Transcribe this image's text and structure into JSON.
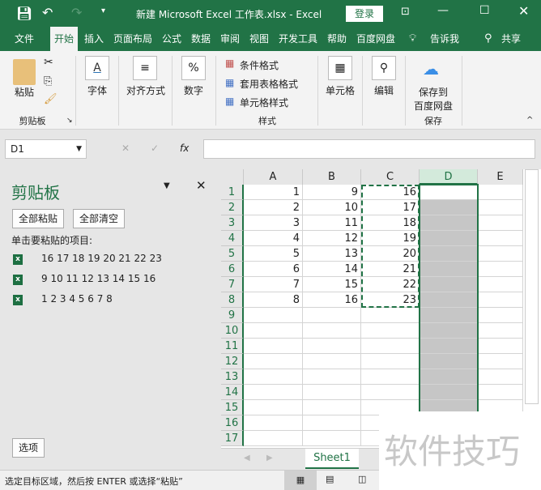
{
  "titlebar": {
    "title": "新建 Microsoft Excel 工作表.xlsx  -  Excel",
    "login": "登录",
    "qat": {
      "save": "save-icon",
      "undo": "undo-icon",
      "redo": "redo-icon"
    }
  },
  "tabs": [
    "文件",
    "开始",
    "插入",
    "页面布局",
    "公式",
    "数据",
    "审阅",
    "视图",
    "开发工具",
    "帮助",
    "百度网盘"
  ],
  "tell_me": "告诉我",
  "share": "共享",
  "active_tab": "开始",
  "ribbon": {
    "paste": "粘贴",
    "clipboard": "剪贴板",
    "font": "字体",
    "alignment": "对齐方式",
    "number": "数字",
    "cond_format": "条件格式",
    "table_format": "套用表格格式",
    "cell_style": "单元格样式",
    "styles": "样式",
    "cells": "单元格",
    "editing": "编辑",
    "save_to": "保存到",
    "baidu": "百度网盘",
    "save": "保存"
  },
  "formula_bar": {
    "name_box": "D1",
    "fx": "fx",
    "value": ""
  },
  "clipboard_pane": {
    "title": "剪贴板",
    "paste_all": "全部粘贴",
    "clear_all": "全部清空",
    "hint": "单击要粘贴的项目:",
    "items": [
      "16 17 18 19 20 21 22 23",
      "9 10 11 12 13 14 15 16",
      "1 2 3 4 5 6 7 8"
    ],
    "options": "选项"
  },
  "sheet": {
    "columns": [
      "A",
      "B",
      "C",
      "D",
      "E"
    ],
    "rows": [
      "1",
      "2",
      "3",
      "4",
      "5",
      "6",
      "7",
      "8",
      "9",
      "10",
      "11",
      "12",
      "13",
      "14",
      "15",
      "16",
      "17"
    ],
    "data": [
      [
        "1",
        "9",
        "16"
      ],
      [
        "2",
        "10",
        "17"
      ],
      [
        "3",
        "11",
        "18"
      ],
      [
        "4",
        "12",
        "19"
      ],
      [
        "5",
        "13",
        "20"
      ],
      [
        "6",
        "14",
        "21"
      ],
      [
        "7",
        "15",
        "22"
      ],
      [
        "8",
        "16",
        "23"
      ]
    ],
    "selected": "D1:D15+",
    "copy_range": "C1:C8",
    "tab": "Sheet1"
  },
  "status": {
    "text": "选定目标区域，然后按 ENTER 或选择“粘贴”"
  },
  "watermark": "软件技巧",
  "colors": {
    "accent": "#217346",
    "selection": "#c6c6c6"
  }
}
